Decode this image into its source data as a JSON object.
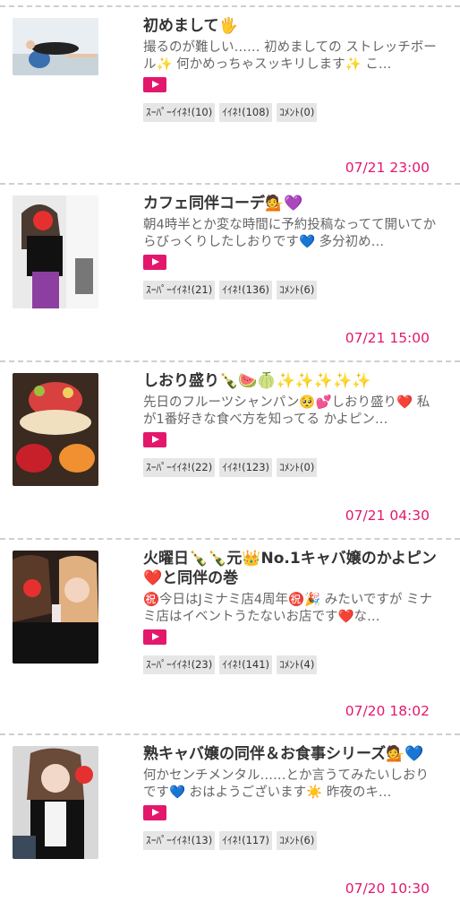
{
  "posts": [
    {
      "title": "初めまして🖐",
      "excerpt": "撮るのが難しい…… 初めましての ストレッチボール✨ 何かめっちゃスッキリします✨ こ…",
      "super_like": "ｽｰﾊﾟｰｲｲﾈ!(10)",
      "like": "ｲｲﾈ!(108)",
      "comment": "ｺﾒﾝﾄ(0)",
      "date": "07/21 23:00"
    },
    {
      "title": "カフェ同伴コーデ💁💜",
      "excerpt": "朝4時半とか変な時間に予約投稿なってて開いてからびっくりしたしおりです💙 多分初め…",
      "super_like": "ｽｰﾊﾟｰｲｲﾈ!(21)",
      "like": "ｲｲﾈ!(136)",
      "comment": "ｺﾒﾝﾄ(6)",
      "date": "07/21 15:00"
    },
    {
      "title": "しおり盛り🍾🍉🍈✨✨✨✨✨",
      "excerpt": "先日のフルーツシャンパン🥺💕しおり盛り❤️ 私が1番好きな食べ方を知ってる かよピン…",
      "super_like": "ｽｰﾊﾟｰｲｲﾈ!(22)",
      "like": "ｲｲﾈ!(123)",
      "comment": "ｺﾒﾝﾄ(0)",
      "date": "07/21 04:30"
    },
    {
      "title": "火曜日🍾🍾元👑No.1キャバ嬢のかよピン❤️と同伴の巻",
      "excerpt": "㊗️今日はJミナミ店4周年㊗️🎉 みたいですが ミナミ店はイベントうたないお店です❤️な…",
      "super_like": "ｽｰﾊﾟｰｲｲﾈ!(23)",
      "like": "ｲｲﾈ!(141)",
      "comment": "ｺﾒﾝﾄ(4)",
      "date": "07/20 18:02"
    },
    {
      "title": "熟キャバ嬢の同伴＆お食事シリーズ💁💙",
      "excerpt": "何かセンチメンタル……とか言うてみたいしおりです💙 おはようございます☀️ 昨夜のキ…",
      "super_like": "ｽｰﾊﾟｰｲｲﾈ!(13)",
      "like": "ｲｲﾈ!(117)",
      "comment": "ｺﾒﾝﾄ(6)",
      "date": "07/20 10:30"
    }
  ]
}
